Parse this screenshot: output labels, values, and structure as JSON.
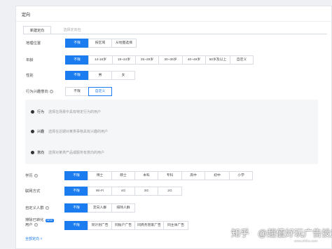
{
  "section": {
    "title": "定向"
  },
  "tabs": [
    {
      "label": "新建定向"
    },
    {
      "label": "选择定向包"
    }
  ],
  "rows": {
    "geo": {
      "label": "地理位置",
      "options": [
        "不限",
        "按区域",
        "从地图选择"
      ]
    },
    "age": {
      "label": "年龄",
      "options": [
        "不限",
        "14-18岁",
        "19~24岁",
        "25~29岁",
        "30~39岁",
        "40~49岁",
        "50岁及以上",
        "自定义"
      ]
    },
    "gender": {
      "label": "性别",
      "options": [
        "不限",
        "男",
        "女"
      ]
    },
    "intent": {
      "label": "行为兴趣意向",
      "options": [
        "不限",
        "自定义"
      ]
    },
    "education": {
      "label": "学历",
      "options": [
        "不限",
        "博士",
        "硕士",
        "本科",
        "专科",
        "高中",
        "初中",
        "小学"
      ]
    },
    "network": {
      "label": "联网方式",
      "options": [
        "不限",
        "Wi-Fi",
        "4G",
        "3G",
        "2G"
      ]
    },
    "custom_audience": {
      "label": "自定义人群",
      "options": [
        "不限",
        "定向人群",
        "排除人群"
      ]
    },
    "exclude_converted": {
      "label_line1": "排除已转化",
      "label_badge": "NEW",
      "label_line2": "用户",
      "options": [
        "不限",
        "同计划广告",
        "同账户广告",
        "同商务管家广告",
        "同主体广告"
      ]
    }
  },
  "behaviors": [
    {
      "name": "行为",
      "desc": "选择在场景中具有特定行为的用户"
    },
    {
      "name": "兴趣",
      "desc": "选择在近期对某类事物具有兴趣的用户"
    },
    {
      "name": "意向",
      "desc": "选择对某类产品或服务有意向的用户"
    }
  ],
  "footer": {
    "link": "全部定向"
  },
  "watermark": {
    "brand": "知乎",
    "author": "@超值好玩广告投放",
    "sub": "www.zhihu.com"
  },
  "colors": {
    "accent": "#1b7cf0"
  }
}
